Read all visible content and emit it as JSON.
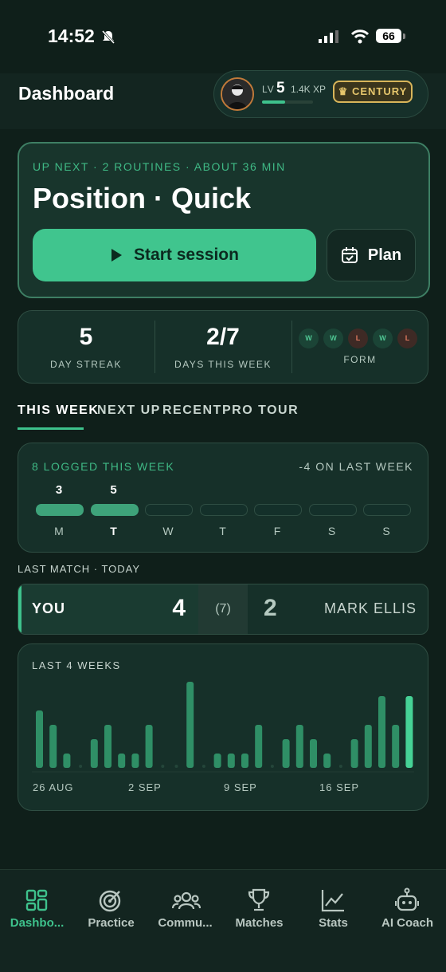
{
  "status_bar": {
    "time": "14:52",
    "battery": "66"
  },
  "header": {
    "title": "Dashboard",
    "level_prefix": "LV",
    "level": "5",
    "xp": "1.4K XP",
    "xp_progress": 0.45,
    "badge": "CENTURY"
  },
  "up_next": {
    "meta": "UP NEXT · 2 ROUTINES · ABOUT 36 MIN",
    "title": "Position · Quick",
    "start_label": "Start session",
    "plan_label": "Plan"
  },
  "stats": {
    "streak_value": "5",
    "streak_label": "DAY STREAK",
    "week_value": "2/7",
    "week_label": "DAYS THIS WEEK",
    "form_label": "FORM",
    "form": [
      "W",
      "W",
      "L",
      "W",
      "L"
    ]
  },
  "tabs": [
    "THIS WEEK",
    "NEXT UP",
    "RECENT",
    "PRO TOUR"
  ],
  "week": {
    "logged": "8 LOGGED THIS WEEK",
    "delta": "-4 ON LAST WEEK",
    "days": [
      {
        "label": "M",
        "count": "3",
        "filled": true
      },
      {
        "label": "T",
        "count": "5",
        "filled": true,
        "today": true
      },
      {
        "label": "W",
        "count": "",
        "filled": false
      },
      {
        "label": "T",
        "count": "",
        "filled": false
      },
      {
        "label": "F",
        "count": "",
        "filled": false
      },
      {
        "label": "S",
        "count": "",
        "filled": false
      },
      {
        "label": "S",
        "count": "",
        "filled": false
      }
    ]
  },
  "last_match": {
    "label": "LAST MATCH · TODAY",
    "you_label": "YOU",
    "you_score": "4",
    "race": "(7)",
    "opp_score": "2",
    "opp_name": "MARK ELLIS"
  },
  "chart_data": {
    "type": "bar",
    "title": "LAST 4 WEEKS",
    "x_tick_labels": [
      "26 AUG",
      "2 SEP",
      "9 SEP",
      "16 SEP"
    ],
    "values": [
      4,
      3,
      1,
      0,
      2,
      3,
      1,
      1,
      3,
      0,
      0,
      6,
      0,
      1,
      1,
      1,
      3,
      0,
      2,
      3,
      2,
      1,
      0,
      2,
      3,
      5,
      3,
      5
    ],
    "highlight_last": true,
    "colors": {
      "bar": "#2f8f66",
      "highlight": "#46d296"
    }
  },
  "tabbar": [
    {
      "label": "Dashbo...",
      "icon": "dashboard-icon",
      "active": true
    },
    {
      "label": "Practice",
      "icon": "target-icon",
      "active": false
    },
    {
      "label": "Commu...",
      "icon": "community-icon",
      "active": false
    },
    {
      "label": "Matches",
      "icon": "trophy-icon",
      "active": false
    },
    {
      "label": "Stats",
      "icon": "stats-chart-icon",
      "active": false
    },
    {
      "label": "AI Coach",
      "icon": "robot-icon",
      "active": false
    }
  ]
}
